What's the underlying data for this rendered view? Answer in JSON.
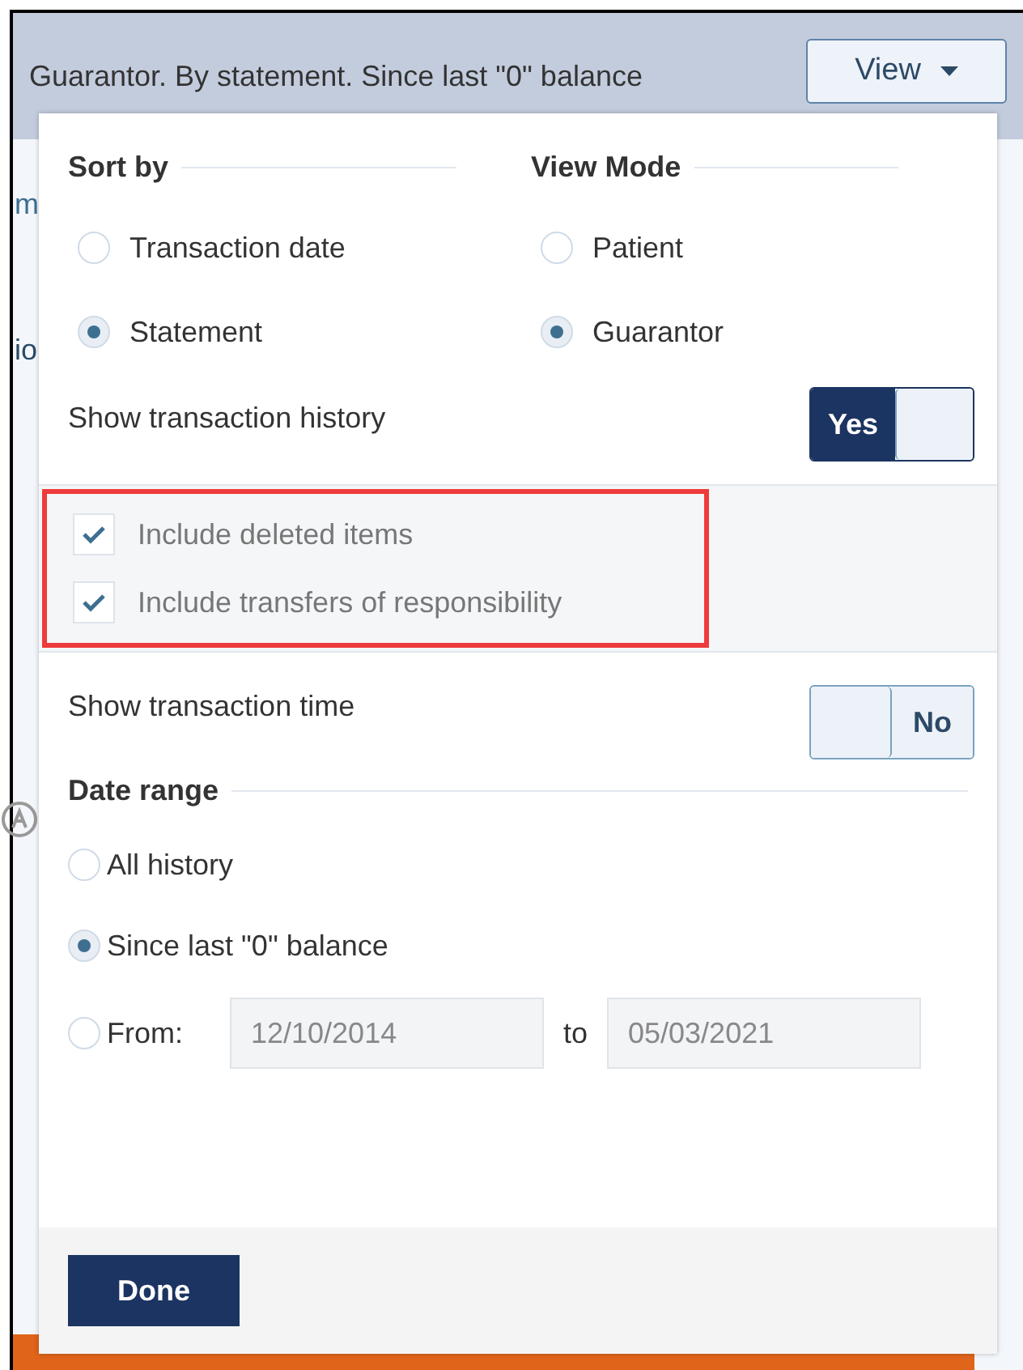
{
  "header": {
    "summary": "Guarantor. By statement. Since last \"0\" balance",
    "view_button": "View"
  },
  "background_fragments": [
    "m",
    "io"
  ],
  "sort_by": {
    "title": "Sort by",
    "options": [
      {
        "label": "Transaction date",
        "selected": false
      },
      {
        "label": "Statement",
        "selected": true
      }
    ]
  },
  "view_mode": {
    "title": "View Mode",
    "options": [
      {
        "label": "Patient",
        "selected": false
      },
      {
        "label": "Guarantor",
        "selected": true
      }
    ]
  },
  "show_transaction_history": {
    "label": "Show transaction history",
    "on": true,
    "value": "Yes"
  },
  "history_options": [
    {
      "label": "Include deleted items",
      "checked": true
    },
    {
      "label": "Include transfers of responsibility",
      "checked": true
    }
  ],
  "show_transaction_time": {
    "label": "Show transaction time",
    "on": false,
    "value": "No"
  },
  "date_range": {
    "title": "Date range",
    "options": [
      {
        "kind": "plain",
        "label": "All history",
        "selected": false
      },
      {
        "kind": "plain",
        "label": "Since last \"0\" balance",
        "selected": true
      },
      {
        "kind": "range",
        "label": "From:",
        "selected": false,
        "from": "12/10/2014",
        "to_label": "to",
        "to": "05/03/2021"
      }
    ]
  },
  "done_button": "Done"
}
